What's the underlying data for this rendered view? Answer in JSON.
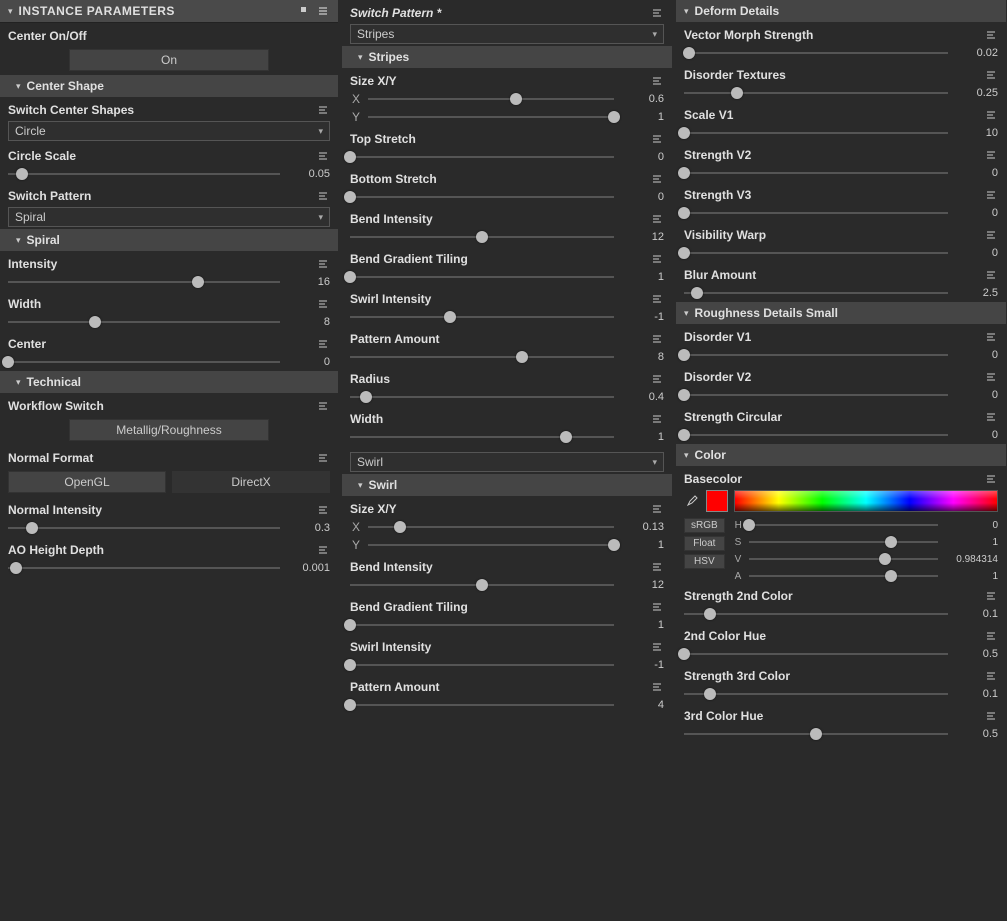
{
  "col1": {
    "header": "INSTANCE PARAMETERS",
    "centerOnOff": {
      "label": "Center On/Off",
      "button": "On"
    },
    "centerShapeHeader": "Center Shape",
    "switchCenterShapes": {
      "label": "Switch Center Shapes",
      "value": "Circle"
    },
    "circleScale": {
      "label": "Circle Scale",
      "value": "0.05",
      "pct": 5
    },
    "switchPattern": {
      "label": "Switch Pattern",
      "value": "Spiral"
    },
    "spiralHeader": "Spiral",
    "intensity": {
      "label": "Intensity",
      "value": "16",
      "pct": 70
    },
    "width": {
      "label": "Width",
      "value": "8",
      "pct": 32
    },
    "center": {
      "label": "Center",
      "value": "0",
      "pct": 0
    },
    "technicalHeader": "Technical",
    "workflow": {
      "label": "Workflow Switch",
      "button": "Metallig/Roughness"
    },
    "normalFormat": {
      "label": "Normal Format",
      "b1": "OpenGL",
      "b2": "DirectX"
    },
    "normalIntensity": {
      "label": "Normal Intensity",
      "value": "0.3",
      "pct": 9
    },
    "aoHeightDepth": {
      "label": "AO Height Depth",
      "value": "0.001",
      "pct": 3
    }
  },
  "col2": {
    "switchPattern": {
      "label": "Switch Pattern *",
      "value": "Stripes"
    },
    "stripesHeader": "Stripes",
    "stripes": {
      "sizeXY": {
        "label": "Size X/Y",
        "x": {
          "value": "0.6",
          "pct": 60
        },
        "y": {
          "value": "1",
          "pct": 100
        }
      },
      "topStretch": {
        "label": "Top Stretch",
        "value": "0",
        "pct": 0
      },
      "bottomStretch": {
        "label": "Bottom Stretch",
        "value": "0",
        "pct": 0
      },
      "bendIntensity": {
        "label": "Bend Intensity",
        "value": "12",
        "pct": 50
      },
      "bendGradTiling": {
        "label": "Bend Gradient Tiling",
        "value": "1",
        "pct": 0
      },
      "swirlIntensity": {
        "label": "Swirl Intensity",
        "value": "-1",
        "pct": 38
      },
      "patternAmount": {
        "label": "Pattern Amount",
        "value": "8",
        "pct": 65
      },
      "radius": {
        "label": "Radius",
        "value": "0.4",
        "pct": 6
      },
      "width": {
        "label": "Width",
        "value": "1",
        "pct": 82
      }
    },
    "swirlDropdown": "Swirl",
    "swirlHeader": "Swirl",
    "swirl": {
      "sizeXY": {
        "label": "Size X/Y",
        "x": {
          "value": "0.13",
          "pct": 13
        },
        "y": {
          "value": "1",
          "pct": 100
        }
      },
      "bendIntensity": {
        "label": "Bend Intensity",
        "value": "12",
        "pct": 50
      },
      "bendGradTiling": {
        "label": "Bend Gradient Tiling",
        "value": "1",
        "pct": 0
      },
      "swirlIntensity": {
        "label": "Swirl Intensity",
        "value": "-1",
        "pct": 0
      },
      "patternAmount": {
        "label": "Pattern Amount",
        "value": "4",
        "pct": 0
      }
    }
  },
  "col3": {
    "deformHeader": "Deform Details",
    "deform": {
      "vectorMorph": {
        "label": "Vector Morph Strength",
        "value": "0.02",
        "pct": 2
      },
      "disorderTex": {
        "label": "Disorder Textures",
        "value": "0.25",
        "pct": 20
      },
      "scaleV1": {
        "label": "Scale V1",
        "value": "10",
        "pct": 0
      },
      "strengthV2": {
        "label": "Strength V2",
        "value": "0",
        "pct": 0
      },
      "strengthV3": {
        "label": "Strength V3",
        "value": "0",
        "pct": 0
      },
      "visWarp": {
        "label": "Visibility Warp",
        "value": "0",
        "pct": 0
      },
      "blurAmount": {
        "label": "Blur Amount",
        "value": "2.5",
        "pct": 5
      }
    },
    "roughHeader": "Roughness Details Small",
    "rough": {
      "disorderV1": {
        "label": "Disorder V1",
        "value": "0",
        "pct": 0
      },
      "disorderV2": {
        "label": "Disorder V2",
        "value": "0",
        "pct": 0
      },
      "strengthCirc": {
        "label": "Strength Circular",
        "value": "0",
        "pct": 0
      }
    },
    "colorHeader": "Color",
    "color": {
      "basecolor": {
        "label": "Basecolor",
        "swatch": "#ff0000",
        "h": {
          "value": "0",
          "pct": 0
        },
        "s": {
          "value": "1",
          "pct": 75
        },
        "v": {
          "value": "0.984314",
          "pct": 72
        },
        "a": {
          "value": "1",
          "pct": 75
        },
        "b1": "sRGB",
        "b2": "Float",
        "b3": "HSV"
      },
      "strength2nd": {
        "label": "Strength 2nd Color",
        "value": "0.1",
        "pct": 10
      },
      "hue2nd": {
        "label": "2nd Color Hue",
        "value": "0.5",
        "pct": 0
      },
      "strength3rd": {
        "label": "Strength 3rd Color",
        "value": "0.1",
        "pct": 10
      },
      "hue3rd": {
        "label": "3rd Color Hue",
        "value": "0.5",
        "pct": 50
      }
    }
  }
}
